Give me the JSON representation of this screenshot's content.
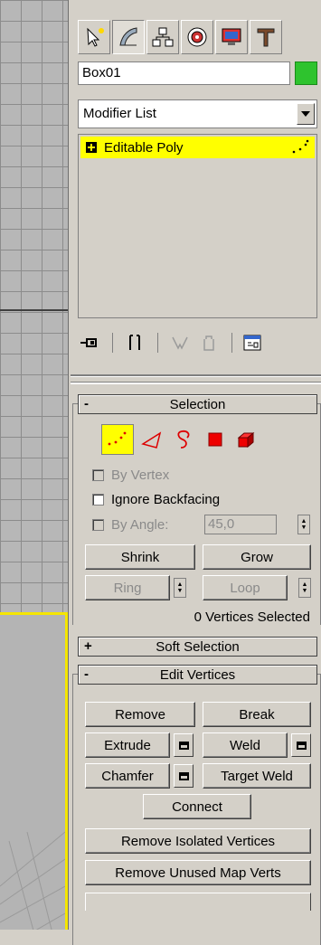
{
  "viewport": {},
  "tabs": [
    {
      "icon": "create-icon"
    },
    {
      "icon": "modify-icon"
    },
    {
      "icon": "hierarchy-icon"
    },
    {
      "icon": "motion-icon"
    },
    {
      "icon": "display-icon"
    },
    {
      "icon": "utilities-icon"
    }
  ],
  "object": {
    "name": "Box01",
    "color": "#2ec32e"
  },
  "modifier_list": {
    "label": "Modifier List"
  },
  "stack": {
    "items": [
      {
        "label": "Editable Poly",
        "expand": "+"
      }
    ]
  },
  "selection": {
    "title": "Selection",
    "collapse": "-",
    "by_vertex": "By Vertex",
    "ignore_backfacing": "Ignore Backfacing",
    "by_angle": "By Angle:",
    "angle_value": "45,0",
    "shrink": "Shrink",
    "grow": "Grow",
    "ring": "Ring",
    "loop": "Loop",
    "status": "0 Vertices Selected"
  },
  "soft_selection": {
    "title": "Soft Selection",
    "expand": "+"
  },
  "edit_vertices": {
    "title": "Edit Vertices",
    "collapse": "-",
    "remove": "Remove",
    "break": "Break",
    "extrude": "Extrude",
    "weld": "Weld",
    "chamfer": "Chamfer",
    "target_weld": "Target Weld",
    "connect": "Connect",
    "remove_isolated": "Remove Isolated Vertices",
    "remove_unused": "Remove Unused Map Verts"
  }
}
